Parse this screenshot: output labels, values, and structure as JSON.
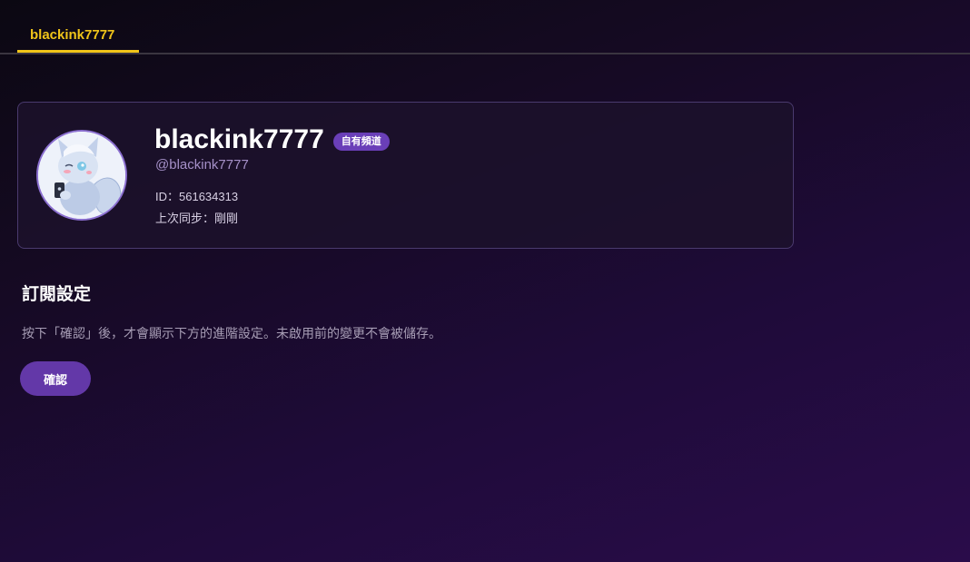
{
  "tabs": [
    {
      "label": "blackink7777",
      "active": true
    }
  ],
  "profile": {
    "display_name": "blackink7777",
    "badge": "自有頻道",
    "handle": "@blackink7777",
    "id_text": "ID：561634313",
    "sync_text": "上次同步：剛剛",
    "avatar_icon": "cat-character-avatar"
  },
  "subscription": {
    "title": "訂閱設定",
    "description": "按下「確認」後，才會顯示下方的進階設定。未啟用前的變更不會被儲存。",
    "confirm_label": "確認"
  },
  "colors": {
    "accent_tab": "#f0c419",
    "badge_bg": "#6a3fb8",
    "button_bg": "#6338a8",
    "card_border": "#4a3a6e"
  }
}
